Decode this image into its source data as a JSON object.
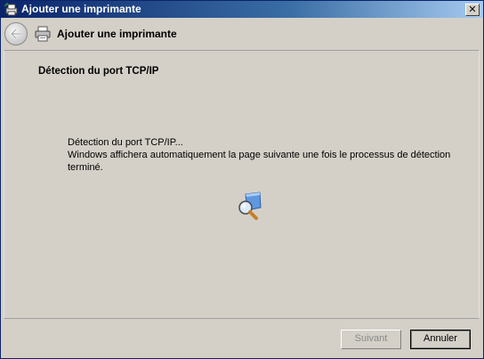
{
  "window": {
    "title": "Ajouter une imprimante",
    "close_glyph": "✕"
  },
  "header": {
    "title": "Ajouter une imprimante"
  },
  "main": {
    "section_title": "Détection du port TCP/IP",
    "line1": "Détection du port TCP/IP...",
    "line2": "Windows affichera automatiquement la page suivante une fois le processus de détection",
    "line3": "terminé."
  },
  "footer": {
    "next_label": "Suivant",
    "cancel_label": "Annuler"
  },
  "icons": {
    "title": "printer-wizard-icon",
    "back": "back-arrow-icon",
    "header": "printer-icon",
    "activity": "search-network-icon"
  },
  "colors": {
    "titlebar_start": "#0a246a",
    "titlebar_end": "#a6caf0",
    "face": "#d4d0c8"
  }
}
